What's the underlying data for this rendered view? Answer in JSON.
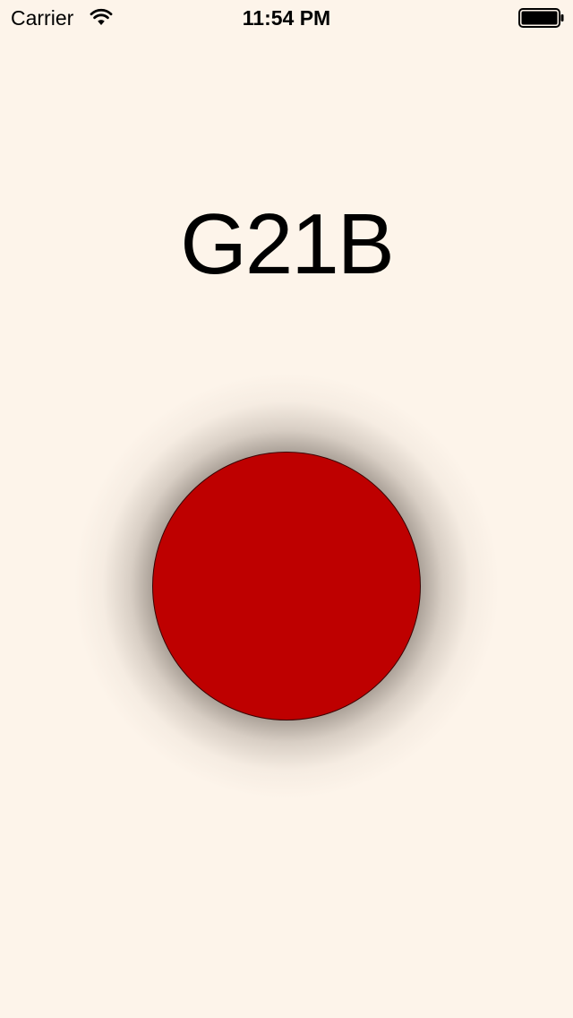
{
  "status_bar": {
    "carrier": "Carrier",
    "time": "11:54 PM",
    "wifi_icon": "wifi-icon",
    "battery_icon": "battery-icon",
    "battery_level": 1.0
  },
  "main": {
    "code": "G21B",
    "button_icon": "circle-button",
    "button_color": "#be0000",
    "background_color": "#fdf4ea"
  }
}
